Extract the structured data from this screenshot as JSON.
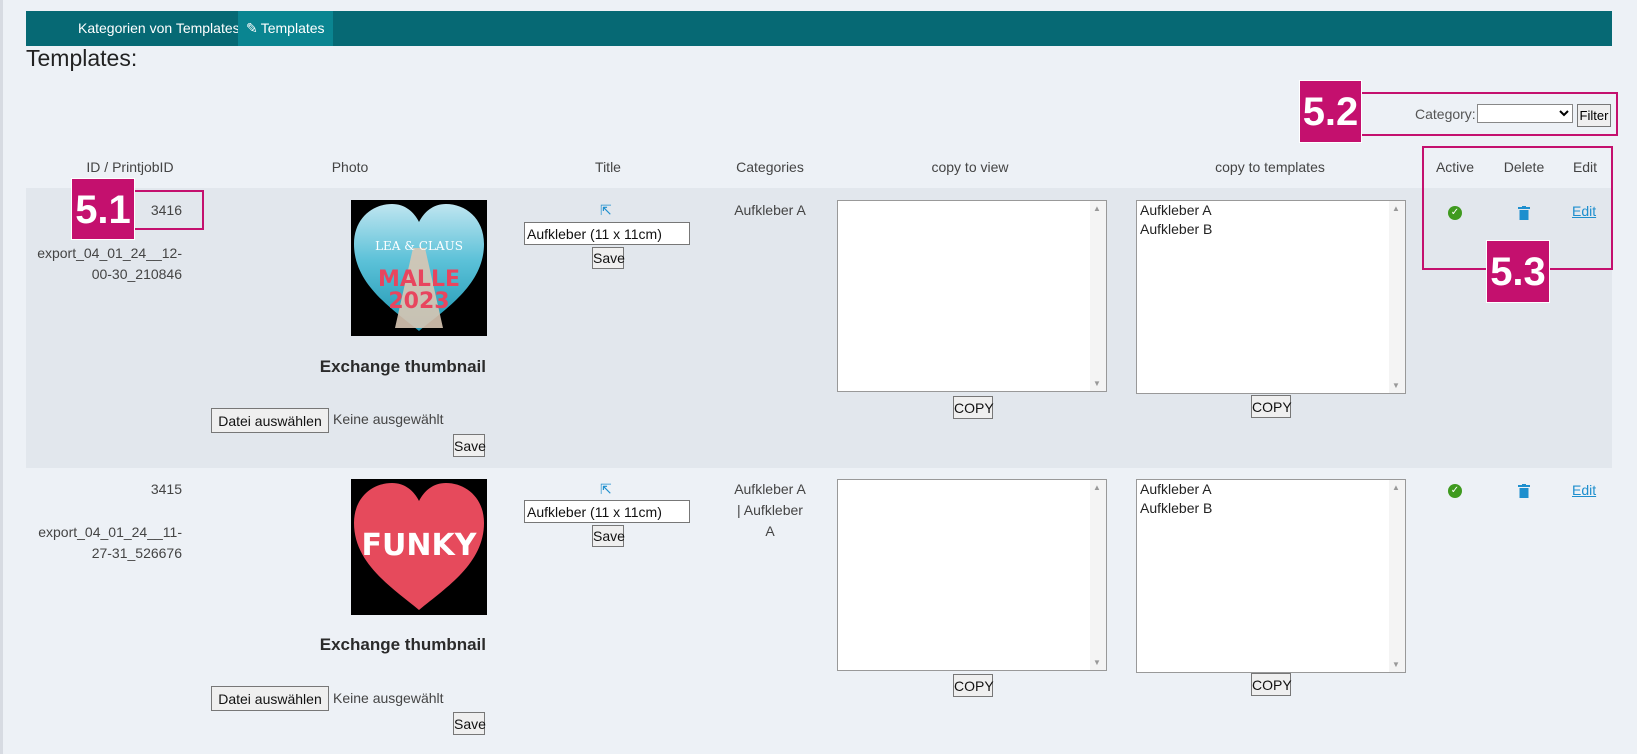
{
  "nav": {
    "tab1": "Kategorien von Templates",
    "tab2": "Templates",
    "tab2_icon": "edit-icon"
  },
  "page": {
    "title": "Templates:"
  },
  "filter": {
    "label": "Category:",
    "selected": "",
    "button": "Filter"
  },
  "columns": {
    "id": "ID / PrintjobID",
    "photo": "Photo",
    "title": "Title",
    "categories": "Categories",
    "copy_view": "copy to view",
    "copy_templates": "copy to templates",
    "active": "Active",
    "delete": "Delete",
    "edit": "Edit"
  },
  "rows": [
    {
      "id": "3416",
      "export": "export_04_01_24__12-00-30_210846",
      "export_line1": "export_04_01_24__12-",
      "export_line2": "00-30_210846",
      "photo_text1": "LEA & CLAUS",
      "photo_text2": "MALLE",
      "photo_text3": "2023",
      "exchange": "Exchange thumbnail",
      "file_button": "Datei auswählen",
      "file_status": "Keine ausgewählt",
      "save_photo": "Save",
      "title_value": "Aufkleber (11 x 11cm)",
      "save_title": "Save",
      "categories_line1": "Aufkleber A",
      "categories_line2": "",
      "categories_line3": "",
      "copy_view_options": [],
      "copy_templates_options": [
        "Aufkleber A",
        "Aufkleber B"
      ],
      "copy_button": "COPY",
      "edit": "Edit"
    },
    {
      "id": "3415",
      "export": "export_04_01_24__11-27-31_526676",
      "export_line1": "export_04_01_24__11-",
      "export_line2": "27-31_526676",
      "photo_text1": "FUNKY",
      "exchange": "Exchange thumbnail",
      "file_button": "Datei auswählen",
      "file_status": "Keine ausgewählt",
      "save_photo": "Save",
      "title_value": "Aufkleber (11 x 11cm)",
      "save_title": "Save",
      "categories_line1": "Aufkleber A",
      "categories_line2": "| Aufkleber",
      "categories_line3": "A",
      "copy_view_options": [],
      "copy_templates_options": [
        "Aufkleber A",
        "Aufkleber B"
      ],
      "copy_button": "COPY",
      "edit": "Edit"
    }
  ],
  "annotations": {
    "a1": "5.1",
    "a2": "5.2",
    "a3": "5.3"
  },
  "colors": {
    "nav": "#066974",
    "nav_active": "#0a8591",
    "annotation": "#c4106e",
    "link": "#1e8fce",
    "active": "#3f9a1f"
  }
}
